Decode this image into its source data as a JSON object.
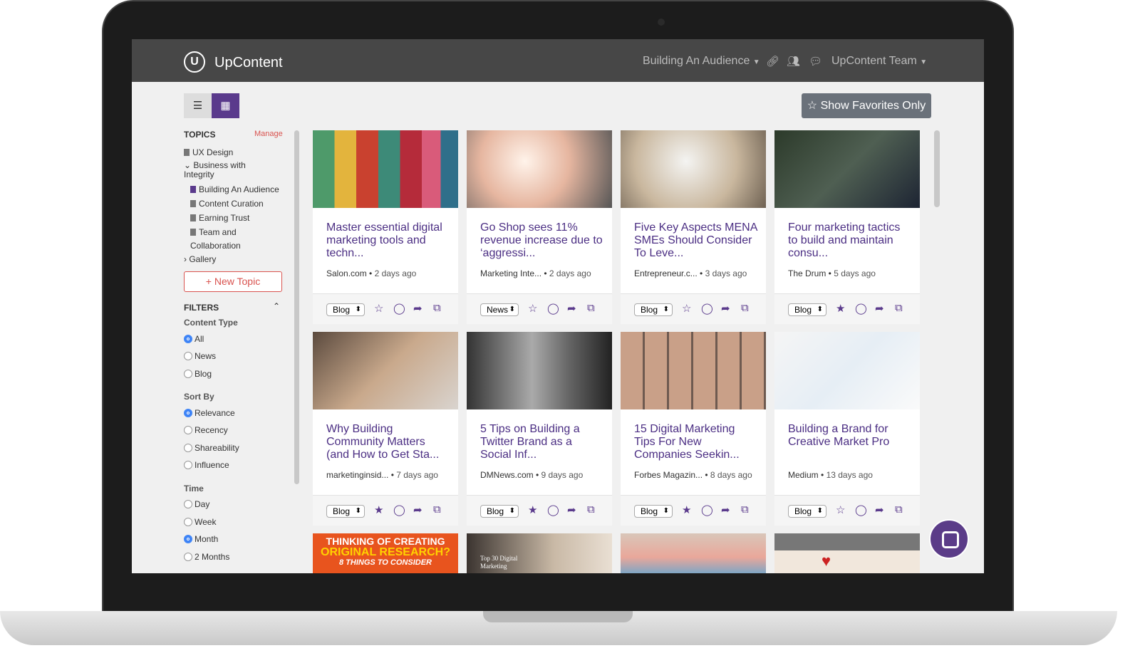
{
  "header": {
    "brand": "UpContent",
    "logo_letter": "U",
    "topic_menu": "Building An Audience",
    "team_menu": "UpContent Team"
  },
  "toolbar": {
    "show_favorites": "Show Favorites Only"
  },
  "sidebar": {
    "topics_heading": "TOPICS",
    "manage": "Manage",
    "topics": [
      "UX Design",
      "Business with Integrity",
      "Building An Audience",
      "Content Curation",
      "Earning Trust",
      "Team and",
      "Collaboration",
      "Gallery"
    ],
    "new_topic": "New Topic",
    "filters_heading": "FILTERS",
    "content_type": {
      "label": "Content Type",
      "options": [
        "All",
        "News",
        "Blog"
      ],
      "selected": "All"
    },
    "sort_by": {
      "label": "Sort By",
      "options": [
        "Relevance",
        "Recency",
        "Shareability",
        "Influence"
      ],
      "selected": "Relevance"
    },
    "time": {
      "label": "Time",
      "options": [
        "Day",
        "Week",
        "Month",
        "2 Months"
      ],
      "selected": "Month"
    }
  },
  "cards": [
    {
      "title": "Master essential digital marketing tools and techn...",
      "source": "Salon.com",
      "age": "2 days ago",
      "type": "Blog",
      "favorite": false
    },
    {
      "title": "Go Shop sees 11% revenue increase due to ‘aggressi...",
      "source": "Marketing Inte...",
      "age": "2 days ago",
      "type": "News",
      "favorite": false
    },
    {
      "title": "Five Key Aspects MENA SMEs Should Consider To Leve...",
      "source": "Entrepreneur.c...",
      "age": "3 days ago",
      "type": "Blog",
      "favorite": false
    },
    {
      "title": "Four marketing tactics to build and maintain consu...",
      "source": "The Drum",
      "age": "5 days ago",
      "type": "Blog",
      "favorite": true
    },
    {
      "title": "Why Building Community Matters (and How to Get Sta...",
      "source": "marketinginsid...",
      "age": "7 days ago",
      "type": "Blog",
      "favorite": true
    },
    {
      "title": "5 Tips on Building a Twitter Brand as a Social Inf...",
      "source": "DMNews.com",
      "age": "9 days ago",
      "type": "Blog",
      "favorite": true
    },
    {
      "title": "15 Digital Marketing Tips For New Companies Seekin...",
      "source": "Forbes Magazin...",
      "age": "8 days ago",
      "type": "Blog",
      "favorite": true
    },
    {
      "title": "Building a Brand for Creative Market Pro",
      "source": "Medium",
      "age": "13 days ago",
      "type": "Blog",
      "favorite": false
    }
  ],
  "partial_cards": {
    "research_line1": "THINKING OF CREATING",
    "research_line2": "ORIGINAL RESEARCH?",
    "research_line3": "8 THINGS TO CONSIDER",
    "top30": "Top 30 Digital Marketing"
  },
  "colors": {
    "accent": "#5a3a8c",
    "title": "#4b2e83",
    "header_bg": "#474747",
    "danger": "#d9534f"
  }
}
